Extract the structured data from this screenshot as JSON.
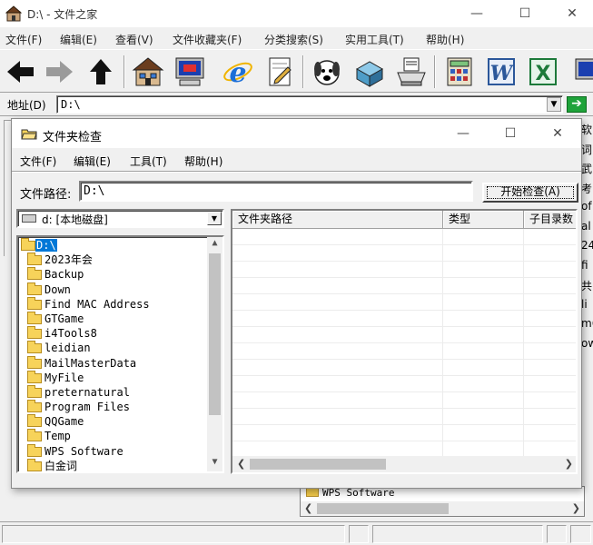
{
  "main_window": {
    "title": "D:\\ - 文件之家",
    "caption": {
      "minimize": "—",
      "maximize": "☐",
      "close": "✕"
    },
    "menu": [
      "文件(F)",
      "编辑(E)",
      "查看(V)",
      "文件收藏夹(F)",
      "分类搜索(S)",
      "实用工具(T)",
      "帮助(H)"
    ],
    "toolbar_icons": [
      "back-arrow-icon",
      "forward-arrow-icon",
      "up-arrow-icon",
      "home-icon",
      "computer-icon",
      "internet-explorer-icon",
      "notepad-icon",
      "dog-icon",
      "package-icon",
      "printer-icon",
      "calculator-icon",
      "word-icon",
      "excel-icon",
      "monitor-icon"
    ],
    "address": {
      "label": "地址(D)",
      "value": "D:\\"
    },
    "right_edge_text": [
      "软",
      "词",
      "武",
      "考",
      "of",
      "al",
      "24",
      "fi",
      "共",
      "li",
      "m6",
      "ow"
    ],
    "background_tree_item": "WPS Software"
  },
  "dialog": {
    "title": "文件夹检查",
    "caption": {
      "minimize": "—",
      "maximize": "☐",
      "close": "✕"
    },
    "menu": [
      "文件(F)",
      "编辑(E)",
      "工具(T)",
      "帮助(H)"
    ],
    "path_label": "文件路径:",
    "path_value": "D:\\",
    "start_button": "开始检查(A)",
    "drive": "d: [本地磁盘]",
    "tree": [
      "D:\\",
      "2023年会",
      "Backup",
      "Down",
      "Find MAC Address",
      "GTGame",
      "i4Tools8",
      "leidian",
      "MailMasterData",
      "MyFile",
      "preternatural",
      "Program Files",
      "QQGame",
      "Temp",
      "WPS Software",
      "白金词"
    ],
    "columns": [
      "文件夹路径",
      "类型",
      "子目录数"
    ]
  },
  "colors": {
    "selection": "#0078d7",
    "folder": "#f7d35a"
  }
}
